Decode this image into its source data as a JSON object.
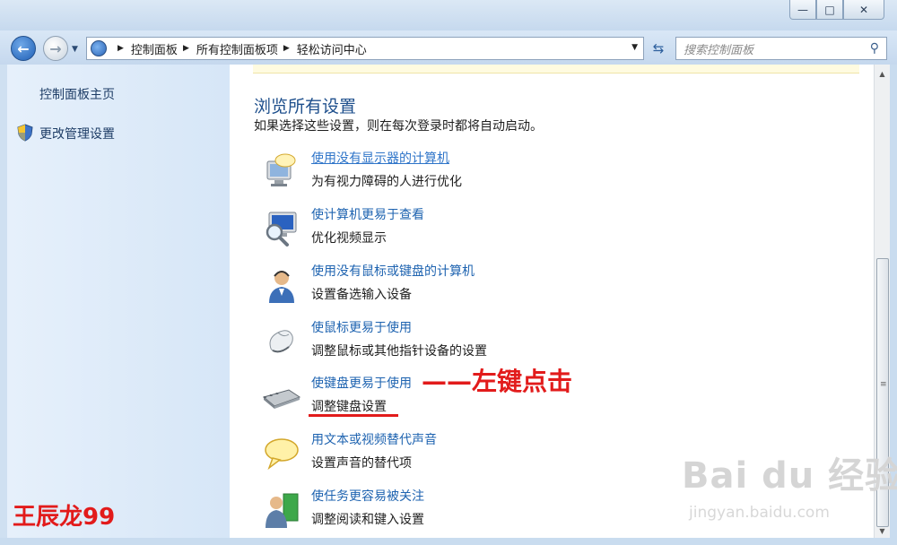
{
  "window": {
    "minimize_glyph": "—",
    "maximize_glyph": "□",
    "close_glyph": "✕"
  },
  "nav": {
    "back_glyph": "←",
    "forward_glyph": "→",
    "breadcrumbs": [
      "控制面板",
      "所有控制面板项",
      "轻松访问中心"
    ],
    "search_placeholder": "搜索控制面板"
  },
  "sidebar": {
    "items": [
      {
        "label": "控制面板主页"
      },
      {
        "label": "更改管理设置",
        "icon": "uac-shield-icon"
      }
    ]
  },
  "main": {
    "title": "浏览所有设置",
    "description": "如果选择这些设置，则在每次登录时都将自动启动。",
    "items": [
      {
        "link": "使用没有显示器的计算机",
        "desc": "为有视力障碍的人进行优化",
        "icon": "monitor-speech-icon"
      },
      {
        "link": "使计算机更易于查看",
        "desc": "优化视频显示",
        "icon": "magnifier-monitor-icon"
      },
      {
        "link": "使用没有鼠标或键盘的计算机",
        "desc": "设置备选输入设备",
        "icon": "user-headset-icon"
      },
      {
        "link": "使鼠标更易于使用",
        "desc": "调整鼠标或其他指针设备的设置",
        "icon": "mouse-icon"
      },
      {
        "link": "使键盘更易于使用",
        "desc": "调整键盘设置",
        "icon": "keyboard-icon"
      },
      {
        "link": "用文本或视频替代声音",
        "desc": "设置声音的替代项",
        "icon": "speech-bubble-icon"
      },
      {
        "link": "使任务更容易被关注",
        "desc": "调整阅读和键入设置",
        "icon": "user-task-icon"
      }
    ]
  },
  "annotations": {
    "arrow_text": "——左键点击",
    "author_name": "王辰龙99",
    "watermark_logo": "Bai du 经验",
    "watermark_url": "jingyan.baidu.com"
  },
  "colors": {
    "link": "#1e63b0",
    "title": "#1e4f8c",
    "annotation": "#e21b1b"
  }
}
